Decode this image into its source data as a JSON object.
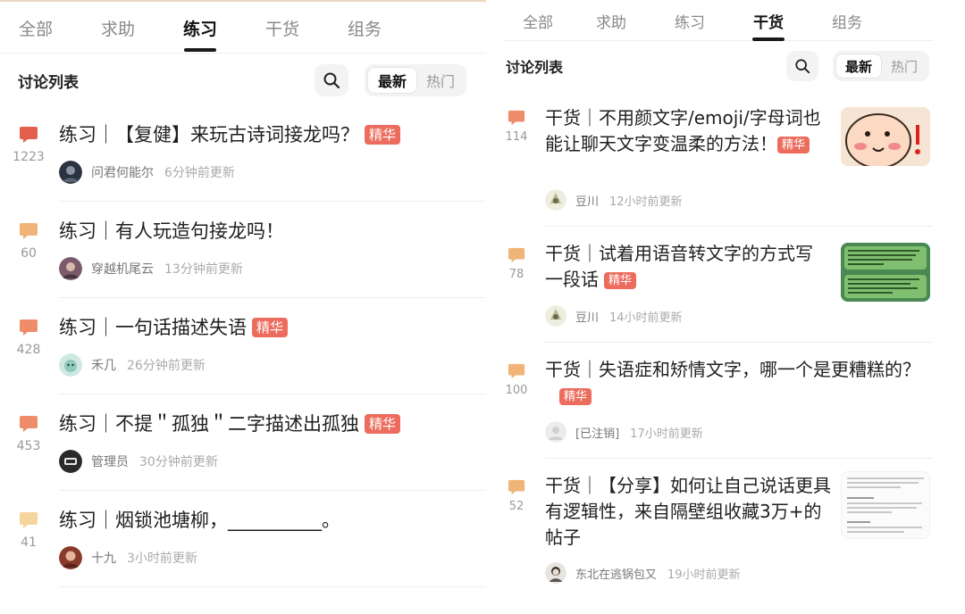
{
  "left": {
    "tabs": [
      "全部",
      "求助",
      "练习",
      "干货",
      "组务"
    ],
    "active_tab": 2,
    "list_title": "讨论列表",
    "sort_options": [
      "最新",
      "热门"
    ],
    "posts": [
      {
        "count": "1223",
        "title": "练习｜【复健】来玩古诗词接龙吗？",
        "badge": "精华",
        "user": "问君何能尔",
        "time": "6分钟前更新",
        "bubble_color": "#e55f4f"
      },
      {
        "count": "60",
        "title": "练习｜有人玩造句接龙吗！",
        "badge": "",
        "user": "穿越机尾云",
        "time": "13分钟前更新",
        "bubble_color": "#f0b478"
      },
      {
        "count": "428",
        "title": "练习｜一句话描述失语",
        "badge": "精华",
        "user": "禾几",
        "time": "26分钟前更新",
        "bubble_color": "#ef8c6a"
      },
      {
        "count": "453",
        "title": "练习｜不提＂孤独＂二字描述出孤独",
        "badge": "精华",
        "user": "管理员",
        "time": "30分钟前更新",
        "bubble_color": "#ef8c6a"
      },
      {
        "count": "41",
        "title": "练习｜烟锁池塘柳，__________。",
        "badge": "",
        "user": "十九",
        "time": "3小时前更新",
        "bubble_color": "#f6d49e"
      }
    ]
  },
  "right": {
    "tabs": [
      "全部",
      "求助",
      "练习",
      "干货",
      "组务"
    ],
    "active_tab": 3,
    "list_title": "讨论列表",
    "sort_options": [
      "最新",
      "热门"
    ],
    "posts": [
      {
        "count": "114",
        "title": "干货｜不用颜文字/emoji/字母词也能让聊天文字变温柔的方法！",
        "badge": "精华",
        "user": "豆川",
        "time": "12小时前更新",
        "bubble_color": "#ef8c6a"
      },
      {
        "count": "78",
        "title": "干货｜试着用语音转文字的方式写一段话",
        "badge": "精华",
        "user": "豆川",
        "time": "14小时前更新",
        "bubble_color": "#f0b478"
      },
      {
        "count": "100",
        "title": "干货｜失语症和矫情文字，哪一个是更糟糕的？",
        "badge": "精华",
        "user": "[已注销]",
        "time": "17小时前更新",
        "bubble_color": "#f0b478"
      },
      {
        "count": "52",
        "title": "干货｜【分享】如何让自己说话更具有逻辑性，来自隔壁组收藏3万+的帖子",
        "badge": "",
        "user": "东北在逃锅包又",
        "time": "19小时前更新",
        "bubble_color": "#f0b478"
      }
    ]
  }
}
